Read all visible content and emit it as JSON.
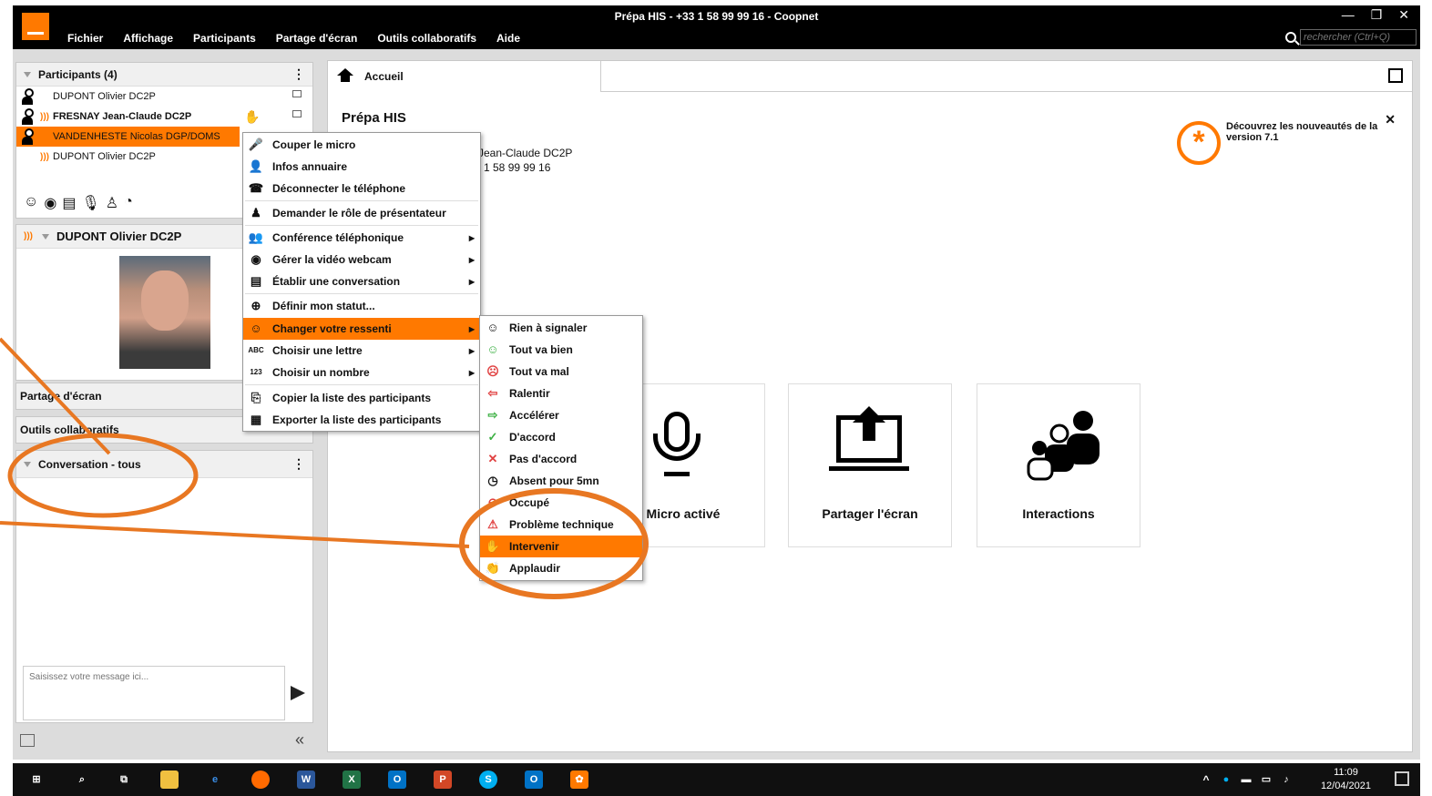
{
  "window": {
    "title": "Prépa HIS - +33 1 58 99 99 16 - Coopnet",
    "search_placeholder": "rechercher (Ctrl+Q)"
  },
  "menubar": [
    "Fichier",
    "Affichage",
    "Participants",
    "Partage d'écran",
    "Outils collaboratifs",
    "Aide"
  ],
  "participants": {
    "header": "Participants (4)",
    "rows": [
      "DUPONT Olivier DC2P",
      "FRESNAY Jean-Claude DC2P",
      "VANDENHESTE Nicolas DGP/DOMS",
      "DUPONT Olivier DC2P"
    ]
  },
  "speaker": {
    "name": "DUPONT Olivier DC2P"
  },
  "sections": {
    "screen_share": "Partage d'écran",
    "collab_tools": "Outils collaboratifs",
    "conversation": "Conversation - tous"
  },
  "chat": {
    "placeholder": "Saisissez votre message ici..."
  },
  "tab": {
    "label": "Accueil"
  },
  "conference": {
    "title": "Prépa HIS",
    "host_partial": "Jean-Claude DC2P",
    "phone_partial": "1 58 99 99 16"
  },
  "news": {
    "text": "Découvrez les nouveautés de la version 7.1"
  },
  "cards": [
    {
      "label": "Micro activé"
    },
    {
      "label": "Partager l'écran"
    },
    {
      "label": "Interactions"
    }
  ],
  "context_menu": {
    "items": [
      "Couper le micro",
      "Infos annuaire",
      "Déconnecter le téléphone",
      "Demander le rôle de présentateur",
      "Conférence téléphonique",
      "Gérer la vidéo webcam",
      "Établir une conversation",
      "Définir mon statut...",
      "Changer votre ressenti",
      "Choisir une lettre",
      "Choisir un nombre",
      "Copier la liste des participants",
      "Exporter la liste des participants"
    ],
    "letter_icon": "ABC",
    "number_icon": "123"
  },
  "submenu": {
    "items": [
      "Rien à signaler",
      "Tout va bien",
      "Tout va mal",
      "Ralentir",
      "Accélérer",
      "D'accord",
      "Pas d'accord",
      "Absent pour 5mn",
      "Occupé",
      "Problème technique",
      "Intervenir",
      "Applaudir"
    ]
  },
  "taskbar": {
    "time": "11:09",
    "date": "12/04/2021"
  },
  "colors": {
    "accent": "#ff7900",
    "titlebar": "#000000"
  }
}
